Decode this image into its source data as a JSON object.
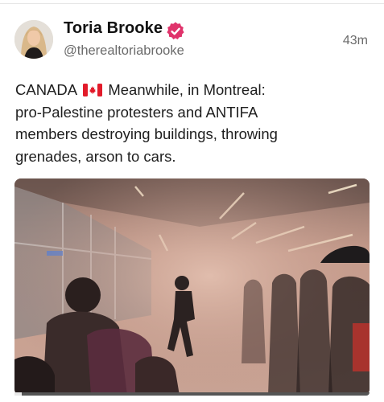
{
  "post": {
    "author_name": "Toria Brooke",
    "author_handle": "@therealtoriabrooke",
    "timestamp": "43m",
    "verified": true,
    "text_lines": [
      {
        "before_flag": "CANADA",
        "after_flag": "Meanwhile, in Montreal:"
      },
      {
        "text": "pro-Palestine protesters and ANTIFA"
      },
      {
        "text": "members destroying buildings, throwing"
      },
      {
        "text": "grenades, arson to cars."
      }
    ]
  },
  "media": {
    "type": "video",
    "progress": 0.02
  },
  "icons": {
    "verified": "verified-badge-icon",
    "flag": "canada-flag-icon"
  },
  "colors": {
    "verified_badge": "#e0336b",
    "text": "#1e1e1e",
    "secondary_text": "#6b6b6b"
  }
}
